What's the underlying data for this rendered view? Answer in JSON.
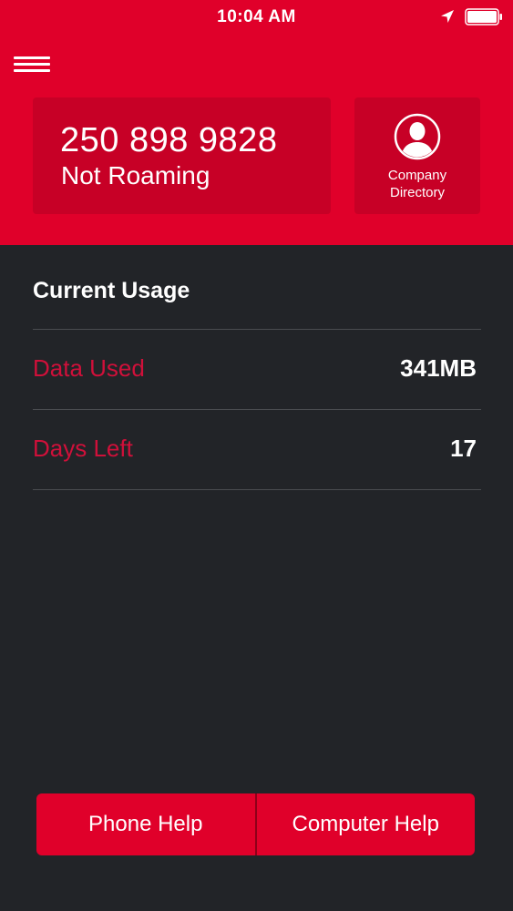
{
  "status_bar": {
    "time": "10:04 AM",
    "icons": [
      "location-arrow-icon",
      "battery-icon"
    ]
  },
  "header": {
    "menu_icon": "hamburger-menu-icon",
    "phone_number": "250 898 9828",
    "roaming_status": "Not Roaming",
    "directory": {
      "icon": "person-icon",
      "label": "Company\nDirectory"
    }
  },
  "usage": {
    "title": "Current Usage",
    "rows": [
      {
        "label": "Data Used",
        "value": "341MB"
      },
      {
        "label": "Days Left",
        "value": "17"
      }
    ]
  },
  "help": {
    "phone_label": "Phone Help",
    "computer_label": "Computer Help"
  },
  "colors": {
    "brand_red": "#e0002a",
    "card_red": "#c70026",
    "background": "#222428",
    "label_red": "#d0103a",
    "divider": "#4a4c50"
  }
}
